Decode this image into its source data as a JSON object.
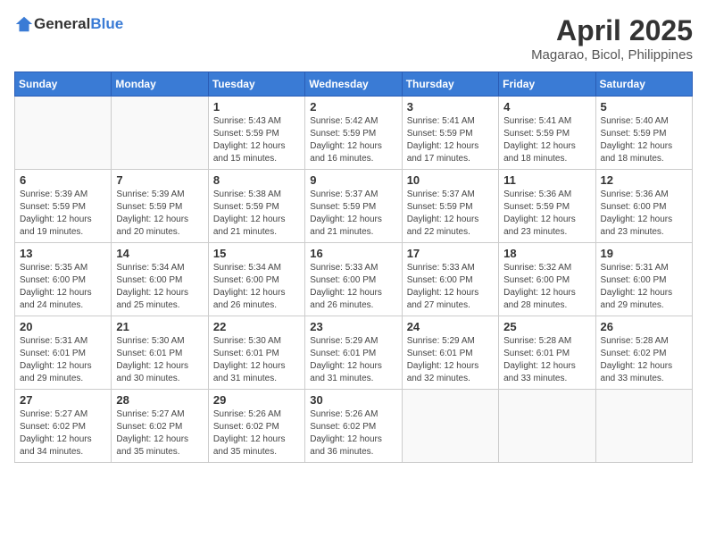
{
  "header": {
    "logo_general": "General",
    "logo_blue": "Blue",
    "month_title": "April 2025",
    "location": "Magarao, Bicol, Philippines"
  },
  "calendar": {
    "days_of_week": [
      "Sunday",
      "Monday",
      "Tuesday",
      "Wednesday",
      "Thursday",
      "Friday",
      "Saturday"
    ],
    "weeks": [
      [
        {
          "day": "",
          "info": ""
        },
        {
          "day": "",
          "info": ""
        },
        {
          "day": "1",
          "info": "Sunrise: 5:43 AM\nSunset: 5:59 PM\nDaylight: 12 hours and 15 minutes."
        },
        {
          "day": "2",
          "info": "Sunrise: 5:42 AM\nSunset: 5:59 PM\nDaylight: 12 hours and 16 minutes."
        },
        {
          "day": "3",
          "info": "Sunrise: 5:41 AM\nSunset: 5:59 PM\nDaylight: 12 hours and 17 minutes."
        },
        {
          "day": "4",
          "info": "Sunrise: 5:41 AM\nSunset: 5:59 PM\nDaylight: 12 hours and 18 minutes."
        },
        {
          "day": "5",
          "info": "Sunrise: 5:40 AM\nSunset: 5:59 PM\nDaylight: 12 hours and 18 minutes."
        }
      ],
      [
        {
          "day": "6",
          "info": "Sunrise: 5:39 AM\nSunset: 5:59 PM\nDaylight: 12 hours and 19 minutes."
        },
        {
          "day": "7",
          "info": "Sunrise: 5:39 AM\nSunset: 5:59 PM\nDaylight: 12 hours and 20 minutes."
        },
        {
          "day": "8",
          "info": "Sunrise: 5:38 AM\nSunset: 5:59 PM\nDaylight: 12 hours and 21 minutes."
        },
        {
          "day": "9",
          "info": "Sunrise: 5:37 AM\nSunset: 5:59 PM\nDaylight: 12 hours and 21 minutes."
        },
        {
          "day": "10",
          "info": "Sunrise: 5:37 AM\nSunset: 5:59 PM\nDaylight: 12 hours and 22 minutes."
        },
        {
          "day": "11",
          "info": "Sunrise: 5:36 AM\nSunset: 5:59 PM\nDaylight: 12 hours and 23 minutes."
        },
        {
          "day": "12",
          "info": "Sunrise: 5:36 AM\nSunset: 6:00 PM\nDaylight: 12 hours and 23 minutes."
        }
      ],
      [
        {
          "day": "13",
          "info": "Sunrise: 5:35 AM\nSunset: 6:00 PM\nDaylight: 12 hours and 24 minutes."
        },
        {
          "day": "14",
          "info": "Sunrise: 5:34 AM\nSunset: 6:00 PM\nDaylight: 12 hours and 25 minutes."
        },
        {
          "day": "15",
          "info": "Sunrise: 5:34 AM\nSunset: 6:00 PM\nDaylight: 12 hours and 26 minutes."
        },
        {
          "day": "16",
          "info": "Sunrise: 5:33 AM\nSunset: 6:00 PM\nDaylight: 12 hours and 26 minutes."
        },
        {
          "day": "17",
          "info": "Sunrise: 5:33 AM\nSunset: 6:00 PM\nDaylight: 12 hours and 27 minutes."
        },
        {
          "day": "18",
          "info": "Sunrise: 5:32 AM\nSunset: 6:00 PM\nDaylight: 12 hours and 28 minutes."
        },
        {
          "day": "19",
          "info": "Sunrise: 5:31 AM\nSunset: 6:00 PM\nDaylight: 12 hours and 29 minutes."
        }
      ],
      [
        {
          "day": "20",
          "info": "Sunrise: 5:31 AM\nSunset: 6:01 PM\nDaylight: 12 hours and 29 minutes."
        },
        {
          "day": "21",
          "info": "Sunrise: 5:30 AM\nSunset: 6:01 PM\nDaylight: 12 hours and 30 minutes."
        },
        {
          "day": "22",
          "info": "Sunrise: 5:30 AM\nSunset: 6:01 PM\nDaylight: 12 hours and 31 minutes."
        },
        {
          "day": "23",
          "info": "Sunrise: 5:29 AM\nSunset: 6:01 PM\nDaylight: 12 hours and 31 minutes."
        },
        {
          "day": "24",
          "info": "Sunrise: 5:29 AM\nSunset: 6:01 PM\nDaylight: 12 hours and 32 minutes."
        },
        {
          "day": "25",
          "info": "Sunrise: 5:28 AM\nSunset: 6:01 PM\nDaylight: 12 hours and 33 minutes."
        },
        {
          "day": "26",
          "info": "Sunrise: 5:28 AM\nSunset: 6:02 PM\nDaylight: 12 hours and 33 minutes."
        }
      ],
      [
        {
          "day": "27",
          "info": "Sunrise: 5:27 AM\nSunset: 6:02 PM\nDaylight: 12 hours and 34 minutes."
        },
        {
          "day": "28",
          "info": "Sunrise: 5:27 AM\nSunset: 6:02 PM\nDaylight: 12 hours and 35 minutes."
        },
        {
          "day": "29",
          "info": "Sunrise: 5:26 AM\nSunset: 6:02 PM\nDaylight: 12 hours and 35 minutes."
        },
        {
          "day": "30",
          "info": "Sunrise: 5:26 AM\nSunset: 6:02 PM\nDaylight: 12 hours and 36 minutes."
        },
        {
          "day": "",
          "info": ""
        },
        {
          "day": "",
          "info": ""
        },
        {
          "day": "",
          "info": ""
        }
      ]
    ]
  }
}
